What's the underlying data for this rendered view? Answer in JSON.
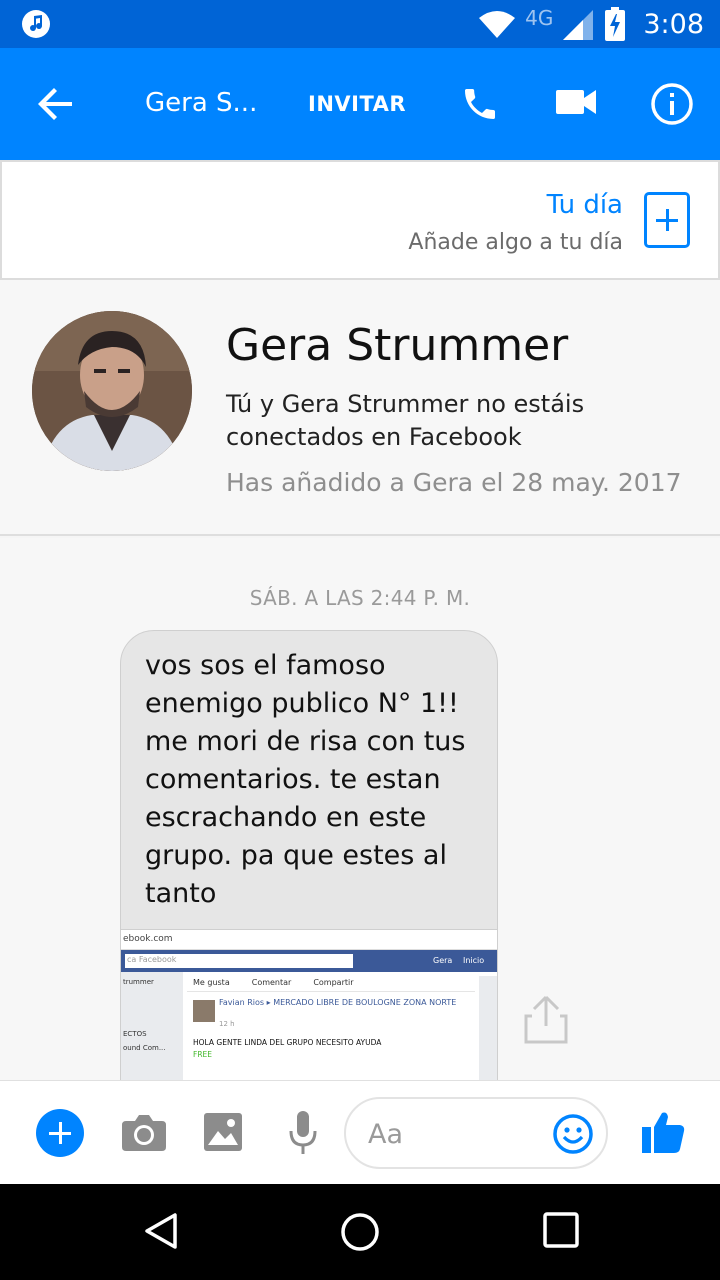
{
  "status_bar": {
    "network": "4G",
    "time": "3:08",
    "icons": [
      "music-icon",
      "wifi-icon",
      "signal-icon",
      "battery-charging-icon"
    ]
  },
  "app_bar": {
    "back_icon": "arrow-left-icon",
    "title": "Gera S...",
    "invite_label": "INVITAR",
    "icons": [
      "phone-icon",
      "video-camera-icon",
      "info-icon"
    ],
    "accent": "#0084ff",
    "status_color": "#0064d6"
  },
  "your_day": {
    "title": "Tu día",
    "subtitle": "Añade algo a tu día",
    "add_icon": "add-story-icon"
  },
  "profile": {
    "name": "Gera Strummer",
    "relationship_note": "Tú y Gera Strummer no estáis conectados en Facebook",
    "added_note": "Has añadido a Gera el 28 may. 2017"
  },
  "thread": {
    "timestamp": "SÁB. A LAS 2:44 P. M.",
    "message_text": "vos sos el famoso enemigo publico N° 1!! me mori de risa con tus comentarios. te estan escrachando en este grupo. pa que estes al tanto",
    "attachment": {
      "address": "ebook.com",
      "search_placeholder": "ca Facebook",
      "user": "Gera",
      "home": "Inicio",
      "side_lines": [
        "trummer",
        "ECTOS",
        "ound Com..."
      ],
      "actions": [
        "Me gusta",
        "Comentar",
        "Compartir"
      ],
      "post_author": "Favian Rios",
      "post_group": "MERCADO LIBRE DE BOULOGNE ZONA NORTE",
      "post_time": "12 h",
      "post_text": "HOLA GENTE LINDA DEL GRUPO NECESITO AYUDA",
      "post_tag": "FREE"
    },
    "share_icon": "share-icon"
  },
  "composer": {
    "placeholder": "Aa",
    "icons": [
      "plus-icon",
      "camera-icon",
      "image-icon",
      "microphone-icon",
      "emoji-icon",
      "thumbs-up-icon"
    ]
  },
  "nav_bar": {
    "icons": [
      "back-triangle-icon",
      "home-circle-icon",
      "recents-square-icon"
    ]
  }
}
